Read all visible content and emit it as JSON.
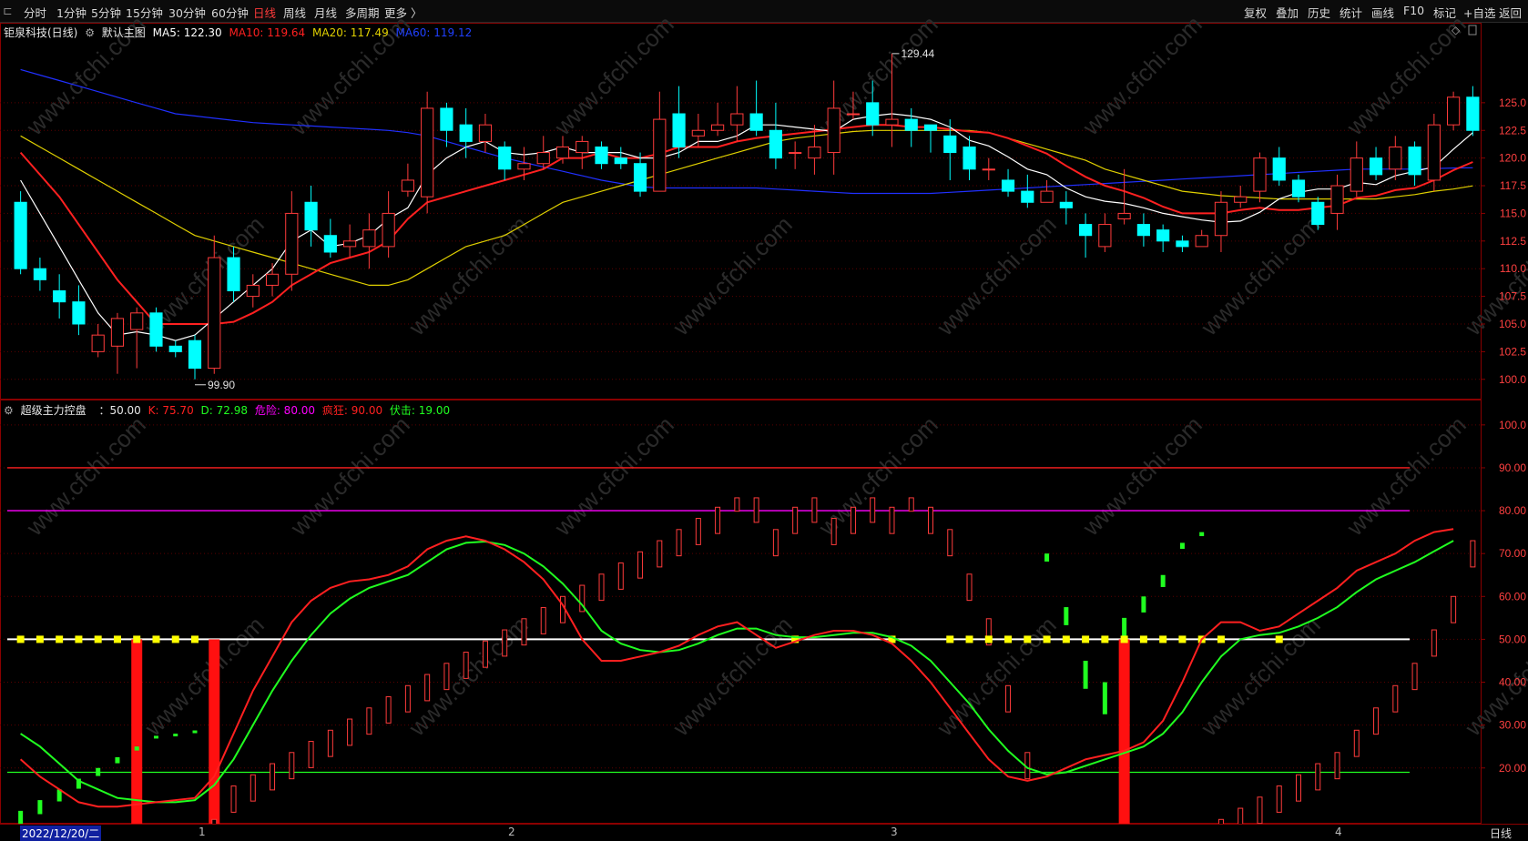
{
  "toolbar": {
    "left_icon": "collapse-icon",
    "periods": [
      "分时",
      "1分钟",
      "5分钟",
      "15分钟",
      "30分钟",
      "60分钟",
      "日线",
      "周线",
      "月线",
      "多周期",
      "更多 〉"
    ],
    "active_period": "日线",
    "right_items": [
      "复权",
      "叠加",
      "历史",
      "统计",
      "画线",
      "F10",
      "标记",
      "+自选",
      "返回"
    ]
  },
  "main_legend": {
    "stock": "钜泉科技(日线)",
    "template": "默认主图",
    "ma5": "MA5: 122.30",
    "ma10": "MA10: 119.64",
    "ma20": "MA20: 117.49",
    "ma60": "MA60: 119.12"
  },
  "sub_legend": {
    "name": "超级主力控盘",
    "value": "：50.00",
    "k": "K: 75.70",
    "d": "D: 72.98",
    "danger": "危险: 80.00",
    "crazy": "疯狂: 90.00",
    "ambush": "伏击: 19.00"
  },
  "colors": {
    "up": "#ff3b3b",
    "down": "#00ffff",
    "ma5": "#ffffff",
    "ma10": "#ff2020",
    "ma20": "#e0d000",
    "ma60": "#2030ff",
    "k": "#ff2020",
    "d": "#20ff20",
    "danger": "#ff00ff",
    "crazy": "#ff2020",
    "ambush": "#20ff20",
    "yellow_mark": "#ffff00"
  },
  "annotations": {
    "high": "129.44",
    "low": "99.90"
  },
  "bottom": {
    "date": "2022/12/20/二",
    "period_label": "日线",
    "months": [
      "1",
      "2",
      "3",
      "4"
    ]
  },
  "watermark": "www.cfchi.com",
  "chart_data": {
    "type": "candlestick",
    "price_axis": {
      "ticks": [
        "125.0",
        "122.5",
        "120.0",
        "117.5",
        "115.0",
        "112.5",
        "110.0",
        "107.5",
        "105.0",
        "102.5",
        "100.0"
      ],
      "range": [
        98.5,
        130.5
      ]
    },
    "indicator_axis": {
      "ticks": [
        "100.0",
        "90.00",
        "80.00",
        "70.00",
        "60.00",
        "50.00",
        "40.00",
        "30.00",
        "20.00"
      ],
      "range": [
        7,
        104
      ]
    },
    "candles": [
      [
        116,
        110,
        117,
        109.5
      ],
      [
        110,
        109,
        111,
        108
      ],
      [
        108,
        107,
        109.5,
        105.5
      ],
      [
        107,
        105,
        108.5,
        104
      ],
      [
        102.5,
        104,
        105,
        102
      ],
      [
        103,
        105.5,
        106,
        100.5
      ],
      [
        104.5,
        106,
        106.5,
        101
      ],
      [
        106,
        103,
        106.5,
        102.5
      ],
      [
        103,
        102.5,
        103.5,
        102
      ],
      [
        103.5,
        101,
        104,
        100
      ],
      [
        101,
        111,
        113,
        100.5
      ],
      [
        111,
        108,
        112,
        107
      ],
      [
        107.5,
        108.5,
        109.5,
        106.5
      ],
      [
        108.5,
        109.5,
        110.5,
        107.5
      ],
      [
        109.5,
        115,
        117,
        108
      ],
      [
        116,
        113.5,
        117.5,
        112
      ],
      [
        113,
        111.5,
        114.5,
        111
      ],
      [
        112,
        112.5,
        114,
        111
      ],
      [
        112,
        113.5,
        115,
        110
      ],
      [
        112,
        115,
        117,
        111
      ],
      [
        117,
        118,
        119.5,
        116.5
      ],
      [
        116.5,
        124.5,
        126,
        115
      ],
      [
        124.5,
        122.5,
        125,
        121
      ],
      [
        123,
        121.5,
        124.5,
        120
      ],
      [
        121.5,
        123,
        124,
        120.5
      ],
      [
        121,
        119,
        121.5,
        118
      ],
      [
        119,
        119.5,
        121,
        118
      ],
      [
        119.5,
        120.5,
        122,
        119
      ],
      [
        120,
        121,
        122,
        119.5
      ],
      [
        120.5,
        121.5,
        122,
        119
      ],
      [
        121,
        119.5,
        121.5,
        119
      ],
      [
        120,
        119.5,
        121,
        119
      ],
      [
        119.5,
        117,
        120.5,
        116.5
      ],
      [
        117,
        123.5,
        126,
        117
      ],
      [
        124,
        121,
        126.5,
        120
      ],
      [
        122,
        122.5,
        124,
        121
      ],
      [
        122.5,
        123,
        125,
        122
      ],
      [
        123,
        124,
        126.5,
        121.5
      ],
      [
        124,
        122.5,
        127,
        122
      ],
      [
        122.5,
        120,
        125,
        119
      ],
      [
        120.5,
        120.5,
        121.5,
        119
      ],
      [
        120,
        121,
        123,
        118.5
      ],
      [
        120.5,
        124.5,
        127,
        118.5
      ],
      [
        124,
        124,
        126,
        123.5
      ],
      [
        125,
        123,
        127,
        122
      ],
      [
        123,
        123.5,
        129.44,
        121
      ],
      [
        123.5,
        122.5,
        124.5,
        121
      ],
      [
        123,
        122.5,
        123,
        120.5
      ],
      [
        122,
        120.5,
        123.5,
        118
      ],
      [
        121,
        119,
        122,
        118
      ],
      [
        119,
        119,
        120,
        118
      ],
      [
        118,
        117,
        119,
        116.5
      ],
      [
        117,
        116,
        118.5,
        115.5
      ],
      [
        116,
        117,
        118,
        116
      ],
      [
        116,
        115.5,
        117,
        114
      ],
      [
        114,
        113,
        115,
        111
      ],
      [
        112,
        114,
        115,
        111.5
      ],
      [
        114.5,
        115,
        119,
        114
      ],
      [
        114,
        113,
        115,
        112
      ],
      [
        113.5,
        112.5,
        114,
        111.5
      ],
      [
        112.5,
        112,
        113,
        111.5
      ],
      [
        112,
        113,
        113.5,
        112
      ],
      [
        113,
        116,
        117,
        111.5
      ],
      [
        116,
        116.5,
        117.5,
        115.5
      ],
      [
        117,
        120,
        120.5,
        116
      ],
      [
        120,
        118,
        121,
        117.5
      ],
      [
        118,
        116.5,
        118.5,
        116
      ],
      [
        116,
        114,
        116.5,
        113.5
      ],
      [
        115,
        117.5,
        118.5,
        113.5
      ],
      [
        117,
        120,
        121.5,
        116.5
      ],
      [
        120,
        118.5,
        121,
        118
      ],
      [
        119,
        121,
        122,
        118
      ],
      [
        121,
        118.5,
        121.5,
        117.5
      ],
      [
        118,
        123,
        124,
        117
      ],
      [
        123,
        125.5,
        126,
        122.5
      ],
      [
        125.5,
        122.5,
        126.5,
        122
      ]
    ],
    "ma5": [
      118,
      115,
      112,
      109,
      106,
      104,
      104.3,
      104,
      103.5,
      104,
      105.5,
      107,
      108.5,
      110,
      112.5,
      113.5,
      112,
      112.3,
      113,
      114.5,
      115.5,
      118.5,
      120,
      121,
      121.5,
      120.5,
      120.3,
      120.5,
      121,
      120.5,
      120.5,
      120.5,
      120,
      120,
      120.5,
      121.5,
      121.5,
      122,
      123,
      123,
      122.8,
      122.6,
      122.4,
      123.5,
      123.8,
      124,
      123.8,
      123.5,
      122.8,
      121.6,
      121.1,
      120.1,
      119,
      118.5,
      117.3,
      116.5,
      116.1,
      115.9,
      115.5,
      115,
      114.7,
      114.4,
      114.2,
      114.3,
      115.1,
      116.3,
      116.9,
      117.2,
      117.2,
      117.8,
      117.6,
      118.4,
      118.8,
      119.2,
      120.8,
      122.3
    ],
    "ma10": [
      120.5,
      118.5,
      116.5,
      114,
      111.5,
      109,
      107,
      105,
      105,
      105,
      105,
      105.2,
      106,
      107,
      108.5,
      109.5,
      110.5,
      111,
      111.5,
      112.5,
      114.5,
      116,
      116.5,
      117,
      117.5,
      118,
      118.5,
      119,
      120,
      120,
      120.5,
      120,
      120,
      120.4,
      121,
      121,
      121,
      121.5,
      121.8,
      122,
      122.2,
      122.4,
      122.6,
      122.8,
      123,
      123,
      122.8,
      122.8,
      122.6,
      122.4,
      122.3,
      121.8,
      121.1,
      120.4,
      119.3,
      118.3,
      117.5,
      117,
      116.4,
      115.6,
      115,
      115,
      115,
      115.3,
      115.5,
      115.3,
      115.3,
      115.5,
      115.7,
      116.4,
      116.6,
      117.1,
      117.3,
      118,
      118.9,
      119.64
    ],
    "ma20": [
      122,
      121,
      120,
      119,
      118,
      117,
      116,
      115,
      114,
      113,
      112.5,
      112,
      111.5,
      111,
      110.5,
      110,
      109.5,
      109,
      108.5,
      108.5,
      109,
      110,
      111,
      112,
      112.5,
      113,
      114,
      115,
      116,
      116.5,
      117,
      117.5,
      118,
      118.5,
      119,
      119.5,
      120,
      120.5,
      121,
      121.5,
      121.8,
      122,
      122.2,
      122.4,
      122.5,
      122.5,
      122.5,
      122.5,
      122.5,
      122.5,
      122.3,
      121.8,
      121.3,
      120.8,
      120.3,
      119.8,
      119,
      118.5,
      118,
      117.5,
      117,
      116.8,
      116.6,
      116.5,
      116.4,
      116.3,
      116.3,
      116.3,
      116.3,
      116.3,
      116.3,
      116.5,
      116.7,
      117,
      117.2,
      117.49
    ],
    "ma60": [
      128,
      127.5,
      127,
      126.5,
      126,
      125.5,
      125,
      124.5,
      124,
      123.8,
      123.6,
      123.4,
      123.2,
      123.1,
      123,
      122.9,
      122.8,
      122.7,
      122.6,
      122.5,
      122.3,
      122,
      121.5,
      121,
      120.5,
      120,
      119.6,
      119.2,
      118.8,
      118.4,
      118,
      117.7,
      117.4,
      117.3,
      117.3,
      117.3,
      117.3,
      117.3,
      117.3,
      117.2,
      117.1,
      117,
      116.9,
      116.8,
      116.8,
      116.8,
      116.8,
      116.8,
      116.9,
      117,
      117.1,
      117.2,
      117.3,
      117.4,
      117.5,
      117.6,
      117.7,
      117.8,
      117.9,
      118,
      118.1,
      118.2,
      118.3,
      118.4,
      118.5,
      118.6,
      118.7,
      118.8,
      118.9,
      119,
      119,
      119,
      119,
      119.05,
      119.1,
      119.12
    ],
    "k": [
      22,
      18,
      15,
      12,
      11,
      11,
      11.5,
      12,
      12.5,
      13,
      18,
      28,
      38,
      46,
      54,
      59,
      62,
      63.5,
      64,
      65,
      67,
      71,
      73,
      74,
      73,
      71,
      68,
      64,
      58,
      50,
      45,
      45,
      46,
      47,
      48.5,
      51,
      53,
      54,
      51,
      48,
      49.5,
      51,
      52,
      52,
      51,
      49,
      45,
      40,
      34,
      28,
      22,
      18,
      17,
      18,
      20,
      22,
      23,
      24,
      26,
      31,
      40,
      50,
      54,
      54,
      52,
      53,
      56,
      59,
      62,
      66,
      68,
      70,
      73,
      75,
      75.7
    ],
    "d": [
      28,
      25,
      21,
      17,
      15,
      13,
      12.5,
      12,
      12,
      12.5,
      16,
      22,
      30,
      38,
      45,
      51,
      56,
      59.5,
      62,
      63.5,
      65,
      68,
      71,
      72.5,
      72.8,
      72,
      70,
      67,
      63,
      58,
      52,
      49,
      47.5,
      47,
      47.5,
      49,
      51,
      52.5,
      52.5,
      51,
      50.5,
      50.5,
      51,
      51.5,
      51.5,
      50.5,
      48.5,
      45,
      40,
      35,
      29,
      24,
      20,
      18.5,
      19,
      20.5,
      22,
      23.5,
      25,
      28,
      33,
      40,
      46,
      50,
      51,
      51.5,
      53,
      55,
      57.5,
      61,
      64,
      66,
      68,
      70.5,
      72.98
    ],
    "signal_heights": [
      -10,
      -7,
      -6,
      -5,
      -4,
      -3,
      -2,
      -1,
      -0.8,
      -0.5,
      0,
      3,
      4,
      5,
      6,
      7,
      8,
      9,
      10,
      11,
      12,
      13,
      14,
      15,
      16,
      17,
      18,
      19,
      20,
      21,
      22,
      23,
      24,
      25,
      26,
      27,
      28,
      30,
      29,
      26,
      28,
      29,
      27,
      28,
      29,
      28,
      30,
      28,
      26,
      22,
      18,
      12,
      6,
      -4,
      -9,
      -14,
      -16,
      -10,
      -8,
      -6,
      -3,
      -2,
      0,
      1,
      2,
      3,
      4,
      5,
      6,
      8,
      10,
      12,
      14,
      17,
      20,
      25
    ]
  }
}
